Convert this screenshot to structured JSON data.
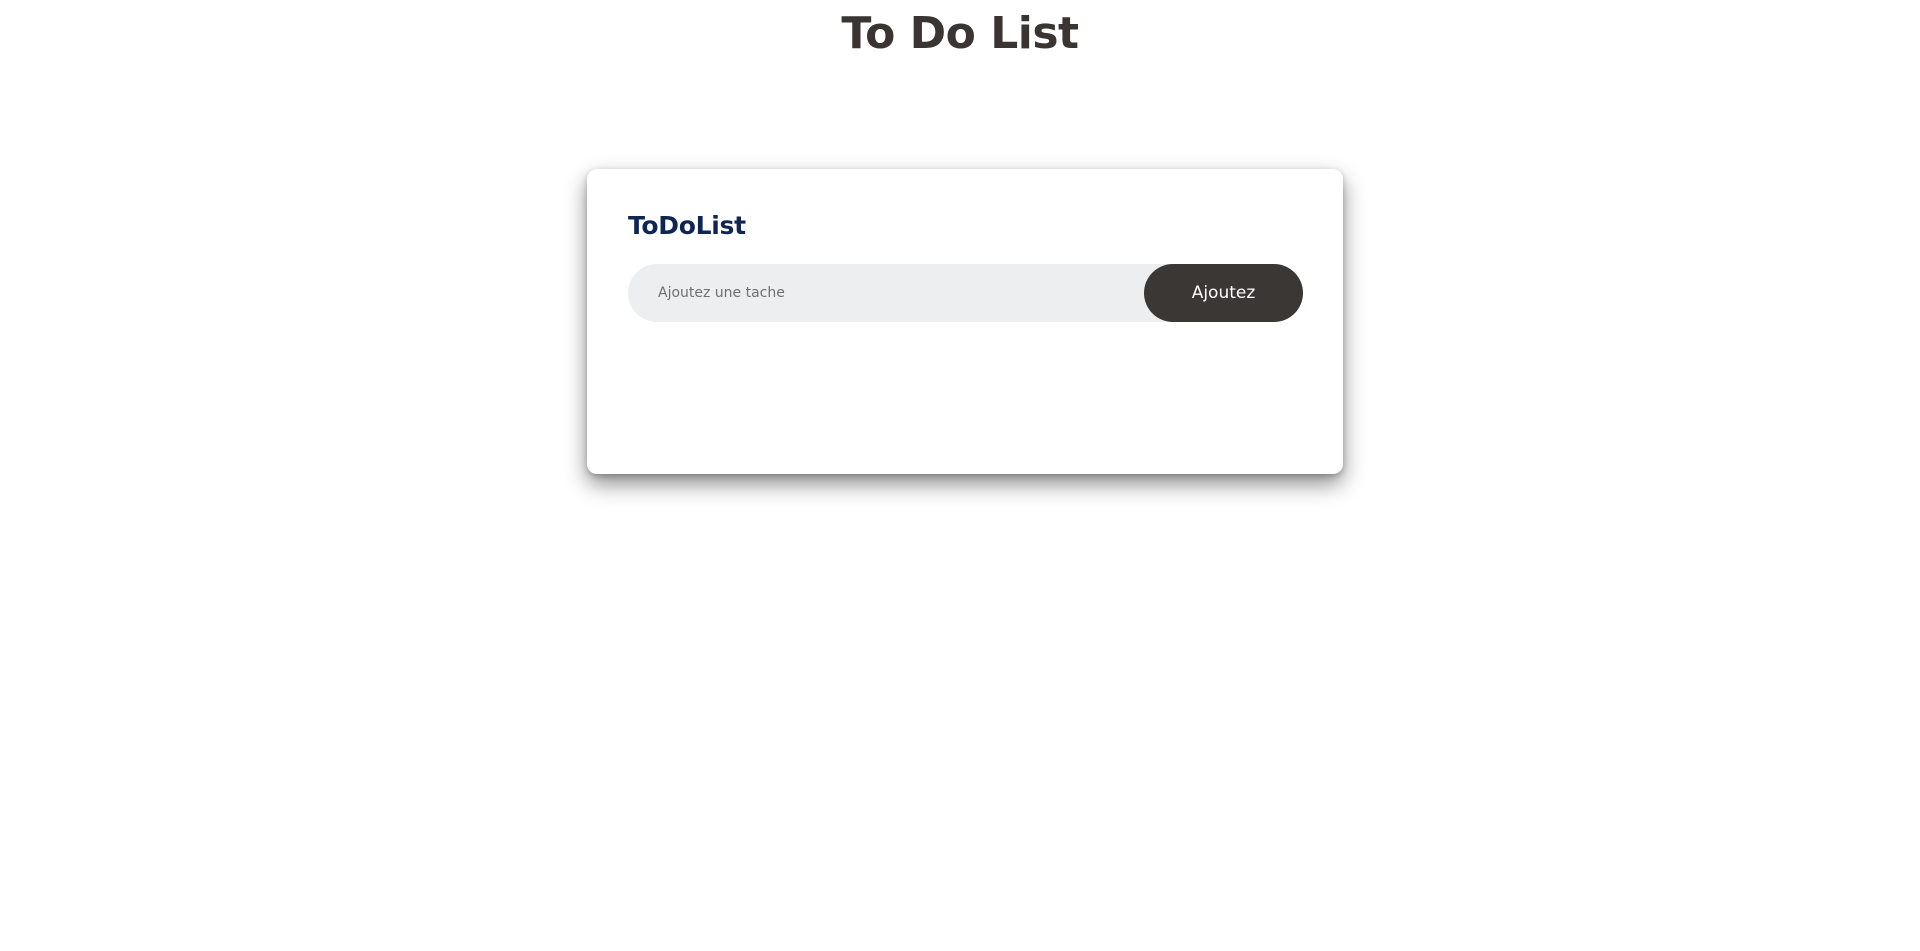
{
  "page": {
    "title": "To Do List"
  },
  "card": {
    "title": "ToDoList",
    "input": {
      "value": "",
      "placeholder": "Ajoutez une tache"
    },
    "add_button_label": "Ajoutez",
    "tasks": []
  },
  "colors": {
    "title_text": "#3a3533",
    "card_title_text": "#0f2552",
    "input_background": "#edeef0",
    "button_background": "#3b3735",
    "button_text": "#ffffff"
  }
}
